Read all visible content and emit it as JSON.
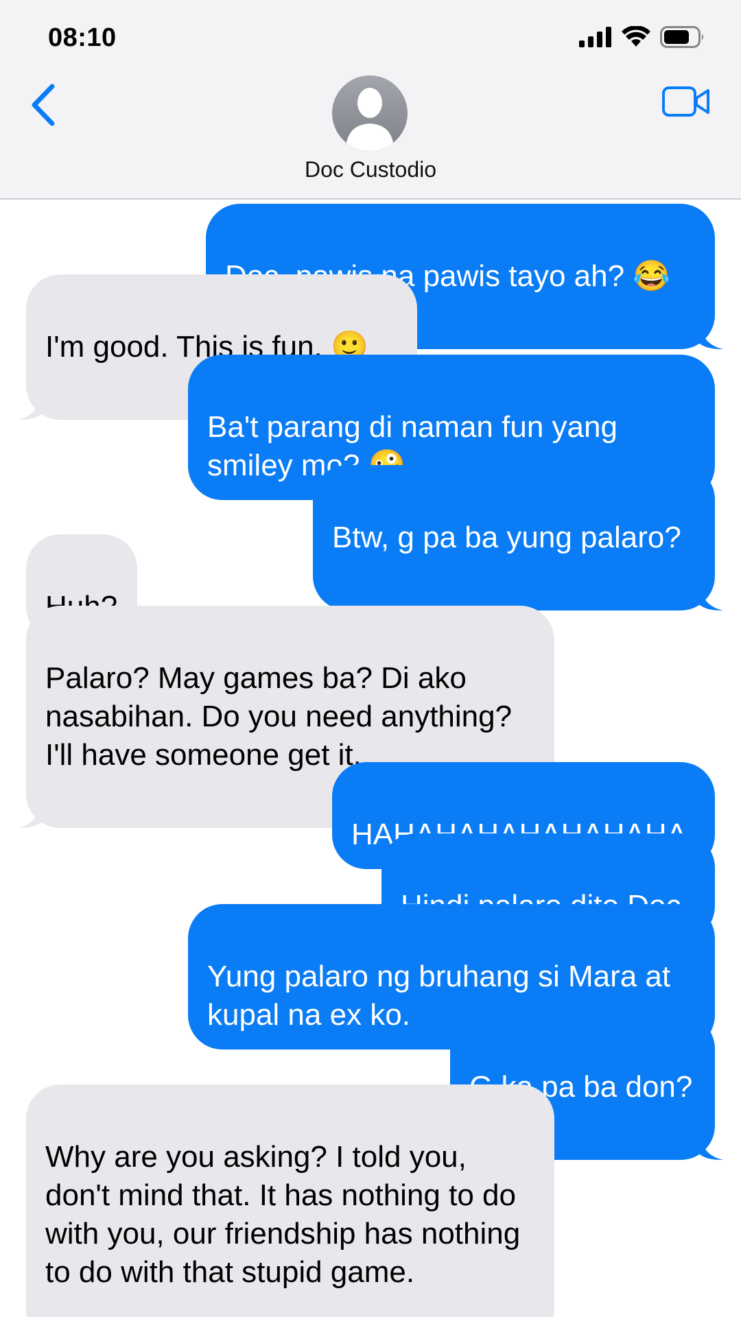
{
  "status_bar": {
    "time": "08:10"
  },
  "header": {
    "contact_name": "Doc Custodio",
    "back_icon": "chevron-left-icon",
    "video_icon": "video-camera-icon",
    "accent_color": "#0a7cf5"
  },
  "messages": [
    {
      "direction": "sent",
      "text": "Doc, pawis na pawis tayo ah? 😂"
    },
    {
      "direction": "received",
      "text": "I'm good. This is fun. 🙂"
    },
    {
      "direction": "sent",
      "text": "Ba't parang di naman fun yang smiley mo? 🤪"
    },
    {
      "direction": "sent",
      "text": "Btw, g pa ba yung palaro?"
    },
    {
      "direction": "received",
      "text": "Huh?"
    },
    {
      "direction": "received",
      "text": "Palaro? May games ba? Di ako nasabihan. Do you need anything? I'll have someone get it."
    },
    {
      "direction": "sent",
      "text": "HAHAHAHAHAHAHAHA"
    },
    {
      "direction": "sent",
      "text": "Hindi palaro dito Doc"
    },
    {
      "direction": "sent",
      "text": "Yung palaro ng bruhang si Mara at kupal na ex ko."
    },
    {
      "direction": "sent",
      "text": "G ka pa ba don?"
    },
    {
      "direction": "received",
      "text": "Why are you asking? I told you, don't mind that. It has nothing to do with you, our friendship has nothing to do with that stupid game."
    }
  ]
}
